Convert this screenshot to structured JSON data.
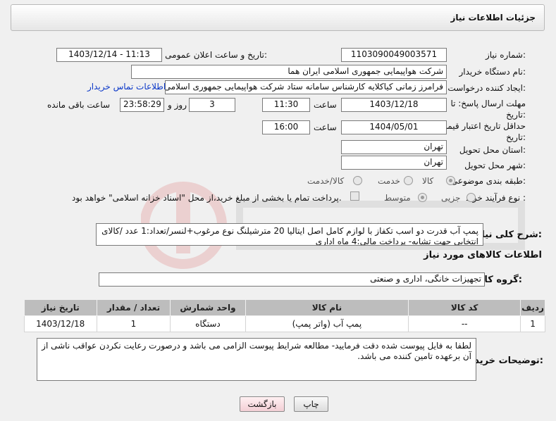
{
  "header": {
    "title": "جزئیات اطلاعات نیاز"
  },
  "form": {
    "need_number": {
      "label": "شماره نیاز:",
      "value": "1103090049003571"
    },
    "announce": {
      "label": "تاریخ و ساعت اعلان عمومی:",
      "value": "1403/12/14 - 11:13"
    },
    "buyer_org": {
      "label": "نام دستگاه خریدار:",
      "value": "شرکت هواپیمایی جمهوری اسلامی ایران هما"
    },
    "creator": {
      "label": "ایجاد کننده درخواست:",
      "value": "فرامرز زمانی کیاکلایه کارشناس سامانه ستاد شرکت هواپیمایی جمهوری اسلامی",
      "contact_link": "اطلاعات تماس خریدار"
    },
    "deadline": {
      "label_line1": "مهلت ارسال پاسخ: تا",
      "label_line2": "تاریخ:",
      "date": "1403/12/18",
      "time_label": "ساعت",
      "time": "11:30",
      "days": "3",
      "days_label": "روز و",
      "remaining": "23:58:29",
      "remaining_label": "ساعت باقی مانده"
    },
    "validity": {
      "label_line1": "حداقل تاریخ اعتبار قیمت: تا",
      "label_line2": "تاریخ:",
      "date": "1404/05/01",
      "time_label": "ساعت",
      "time": "16:00"
    },
    "province": {
      "label": "استان محل تحویل:",
      "value": "تهران"
    },
    "city": {
      "label": "شهر محل تحویل:",
      "value": "تهران"
    },
    "category": {
      "label": "طبقه بندی موضوعی:",
      "options": [
        "کالا",
        "خدمت",
        "کالا/خدمت"
      ],
      "selected": "کالا"
    },
    "process": {
      "label": "نوع فرآیند خرید :",
      "options": [
        "جزیی",
        "متوسط"
      ],
      "selected": "متوسط",
      "checkbox_text": "پرداخت تمام یا بخشی از مبلغ خرید،از محل \"اسناد خزانه اسلامی\" خواهد بود."
    }
  },
  "summary": {
    "label": "شرح کلی نیاز:",
    "text": "پمپ آب قدرت دو اسب تکفاز با لوازم کامل اصل ایتالیا 20 مترشیلنگ نوع مرغوب+لنسر/تعداد:1 عدد /کالای انتخابی جهت تشابه- پرداخت مالی:4 ماه اداری"
  },
  "goods": {
    "section_title": "اطلاعات کالاهای مورد نیاز",
    "group_label": "گروه کالا:",
    "group_value": "تجهیزات خانگی، اداری و صنعتی",
    "columns": [
      "ردیف",
      "کد کالا",
      "نام کالا",
      "واحد شمارش",
      "تعداد / مقدار",
      "تاریخ نیاز"
    ],
    "rows": [
      {
        "row": "1",
        "code": "--",
        "name": "پمپ آب (واتر پمپ)",
        "unit": "دستگاه",
        "qty": "1",
        "date": "1403/12/18"
      }
    ]
  },
  "buyer_notes": {
    "label": "توضیحات خریدار:",
    "text": "لطفا به فایل پیوست شده دقت فرمایید- مطالعه شرایط پیوست الزامی می باشد و درصورت رعایت نکردن عواقب ناشی از آن برعهده تامین کننده می باشد."
  },
  "buttons": {
    "print": "چاپ",
    "back": "بازگشت"
  },
  "colors": {
    "link": "#0a37c8",
    "table_header": "#bdbdbd",
    "back_button": "#f3cfd5"
  }
}
